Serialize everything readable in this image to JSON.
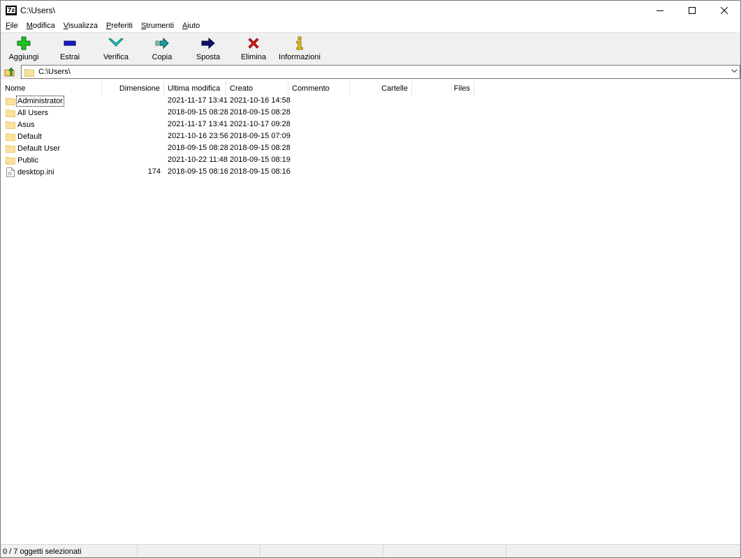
{
  "window": {
    "app_icon_text": "7z",
    "title": "C:\\Users\\"
  },
  "menu": [
    {
      "accel": "F",
      "rest": "ile"
    },
    {
      "accel": "M",
      "rest": "odifica"
    },
    {
      "accel": "V",
      "rest": "isualizza"
    },
    {
      "accel": "P",
      "rest": "referiti"
    },
    {
      "accel": "S",
      "rest": "trumenti"
    },
    {
      "accel": "A",
      "rest": "iuto"
    }
  ],
  "toolbar": {
    "add": "Aggiungi",
    "extract": "Estrai",
    "test": "Verifica",
    "copy": "Copia",
    "move": "Sposta",
    "delete": "Elimina",
    "info": "Informazioni"
  },
  "address": {
    "path": "C:\\Users\\"
  },
  "columns": {
    "name": "Nome",
    "size": "Dimensione",
    "modified": "Ultima modifica",
    "created": "Creato",
    "comment": "Commento",
    "folders": "Cartelle",
    "files": "Files"
  },
  "items": [
    {
      "name": "Administrator",
      "type": "folder",
      "size": "",
      "modified": "2021-11-17 13:41",
      "created": "2021-10-16 14:58"
    },
    {
      "name": "All Users",
      "type": "folder",
      "size": "",
      "modified": "2018-09-15 08:28",
      "created": "2018-09-15 08:28"
    },
    {
      "name": "Asus",
      "type": "folder",
      "size": "",
      "modified": "2021-11-17 13:41",
      "created": "2021-10-17 09:28"
    },
    {
      "name": "Default",
      "type": "folder",
      "size": "",
      "modified": "2021-10-16 23:56",
      "created": "2018-09-15 07:09"
    },
    {
      "name": "Default User",
      "type": "folder",
      "size": "",
      "modified": "2018-09-15 08:28",
      "created": "2018-09-15 08:28"
    },
    {
      "name": "Public",
      "type": "folder",
      "size": "",
      "modified": "2021-10-22 11:48",
      "created": "2018-09-15 08:19"
    },
    {
      "name": "desktop.ini",
      "type": "file",
      "size": "174",
      "modified": "2018-09-15 08:16",
      "created": "2018-09-15 08:16"
    }
  ],
  "status": {
    "selection": "0 / 7 oggetti selezionati"
  }
}
